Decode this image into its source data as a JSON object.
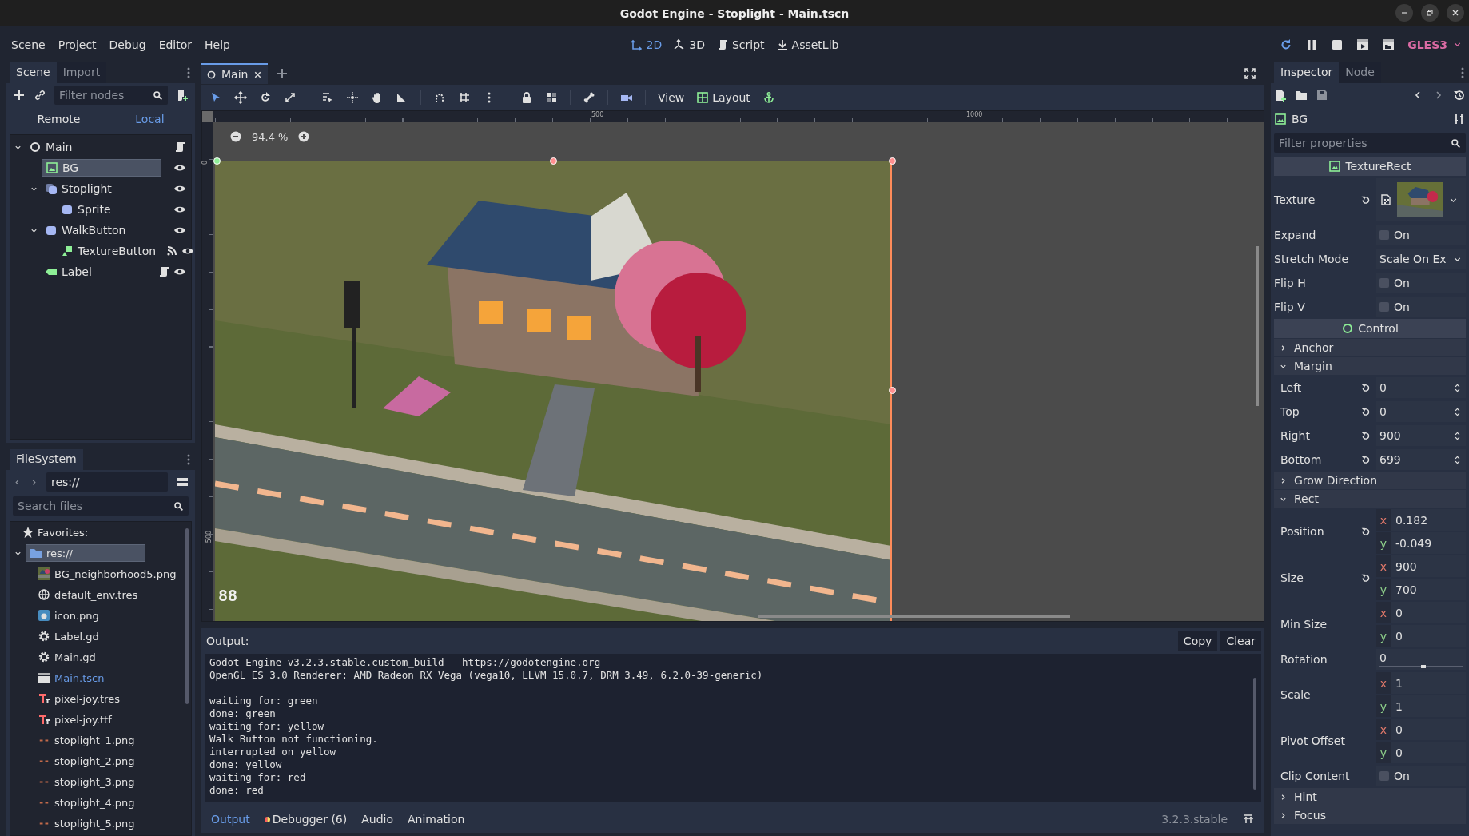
{
  "window": {
    "title": "Godot Engine - Stoplight - Main.tscn"
  },
  "menu": [
    "Scene",
    "Project",
    "Debug",
    "Editor",
    "Help"
  ],
  "workspaces": [
    {
      "label": "2D",
      "kind": "planar",
      "selected": true
    },
    {
      "label": "3D",
      "kind": "spatial",
      "selected": false
    },
    {
      "label": "Script",
      "kind": "script",
      "selected": false
    },
    {
      "label": "AssetLib",
      "kind": "assetlib",
      "selected": false
    }
  ],
  "renderer": "GLES3",
  "scene_dock": {
    "tabs": [
      {
        "label": "Scene",
        "selected": true
      },
      {
        "label": "Import",
        "selected": false
      }
    ],
    "filter": {
      "placeholder": "Filter nodes"
    },
    "modes": [
      {
        "label": "Remote",
        "selected": false
      },
      {
        "label": "Local",
        "selected": true
      }
    ],
    "tree": [
      {
        "name": "Main",
        "kind": "node",
        "script": true,
        "signals": false,
        "selected": false,
        "expanded": true,
        "children": [
          {
            "name": "BG",
            "kind": "texture_rect",
            "script": false,
            "signals": false,
            "selected": true
          },
          {
            "name": "Stoplight",
            "kind": "animated_sprite",
            "script": false,
            "signals": false,
            "selected": false,
            "expanded": true,
            "children": [
              {
                "name": "Sprite",
                "kind": "sprite",
                "script": false,
                "signals": false,
                "selected": false
              }
            ]
          },
          {
            "name": "WalkButton",
            "kind": "sprite",
            "script": false,
            "signals": false,
            "selected": false,
            "expanded": true,
            "children": [
              {
                "name": "TextureButton",
                "kind": "texture_button",
                "script": false,
                "signals": true,
                "selected": false
              }
            ]
          },
          {
            "name": "Label",
            "kind": "label",
            "script": true,
            "signals": false,
            "selected": false
          }
        ]
      }
    ]
  },
  "filesystem": {
    "tabs": [
      {
        "label": "FileSystem",
        "selected": true
      }
    ],
    "path": "res://",
    "search": {
      "placeholder": "Search files"
    },
    "favorites": "Favorites:",
    "tree": [
      {
        "name": "res://",
        "kind": "folder",
        "selected": true,
        "open": false,
        "expanded": true,
        "children": [
          {
            "name": "BG_neighborhood5.png",
            "kind": "thumbnail",
            "selected": false,
            "open": false
          },
          {
            "name": "default_env.tres",
            "kind": "environment",
            "selected": false,
            "open": false
          },
          {
            "name": "icon.png",
            "kind": "app_image",
            "selected": false,
            "open": false
          },
          {
            "name": "Label.gd",
            "kind": "script",
            "selected": false,
            "open": false
          },
          {
            "name": "Main.gd",
            "kind": "script",
            "selected": false,
            "open": false
          },
          {
            "name": "Main.tscn",
            "kind": "scene",
            "selected": false,
            "open": true
          },
          {
            "name": "pixel-joy.tres",
            "kind": "font",
            "selected": false,
            "open": false
          },
          {
            "name": "pixel-joy.ttf",
            "kind": "font",
            "selected": false,
            "open": false
          },
          {
            "name": "stoplight_1.png",
            "kind": "frame",
            "selected": false,
            "open": false
          },
          {
            "name": "stoplight_2.png",
            "kind": "frame",
            "selected": false,
            "open": false
          },
          {
            "name": "stoplight_3.png",
            "kind": "frame",
            "selected": false,
            "open": false
          },
          {
            "name": "stoplight_4.png",
            "kind": "frame",
            "selected": false,
            "open": false
          },
          {
            "name": "stoplight_5.png",
            "kind": "frame",
            "selected": false,
            "open": false
          }
        ]
      }
    ]
  },
  "editor": {
    "tabs": [
      {
        "label": "Main",
        "selected": true
      }
    ],
    "view_menu": "View",
    "layout_menu": "Layout",
    "zoom": "94.4 %",
    "ruler": {
      "x_labels": [
        "500",
        "1000"
      ],
      "y_labels": [
        "0",
        "500"
      ]
    },
    "canvas_label": "88"
  },
  "output": {
    "title": "Output:",
    "buttons": [
      "Copy",
      "Clear"
    ],
    "blocks": [
      [
        "Godot Engine v3.2.3.stable.custom_build - https://godotengine.org",
        "OpenGL ES 3.0 Renderer: AMD Radeon RX Vega (vega10, LLVM 15.0.7, DRM 3.49, 6.2.0-39-generic)"
      ],
      [
        "waiting for: green",
        "done: green",
        "waiting for: yellow",
        "Walk Button not functioning.",
        "interrupted on yellow",
        "done: yellow",
        "waiting for: red",
        "done: red"
      ]
    ]
  },
  "bottom_tabs": [
    {
      "label": "Output",
      "selected": true
    },
    {
      "label": "Debugger (6)",
      "selected": false
    },
    {
      "label": "Audio",
      "selected": false
    },
    {
      "label": "Animation",
      "selected": false
    }
  ],
  "version": "3.2.3.stable",
  "inspector": {
    "tabs": [
      {
        "label": "Inspector",
        "selected": true
      },
      {
        "label": "Node",
        "selected": false
      }
    ],
    "object": "BG",
    "filter": {
      "placeholder": "Filter properties"
    },
    "properties": [
      {
        "kind": "header",
        "label": "TextureRect"
      },
      {
        "kind": "texture",
        "label": "Texture",
        "revert": true
      },
      {
        "kind": "check",
        "label": "Expand",
        "checked": false,
        "text": "On"
      },
      {
        "kind": "enum",
        "label": "Stretch Mode",
        "value": "Scale On Ex"
      },
      {
        "kind": "check",
        "label": "Flip H",
        "checked": false,
        "text": "On"
      },
      {
        "kind": "check",
        "label": "Flip V",
        "checked": false,
        "text": "On"
      },
      {
        "kind": "header",
        "label": "Control"
      },
      {
        "kind": "group",
        "label": "Anchor",
        "expanded": false
      },
      {
        "kind": "group",
        "label": "Margin",
        "expanded": true,
        "children": [
          {
            "kind": "spin",
            "label": "Left",
            "value": "0",
            "revert": true
          },
          {
            "kind": "spin",
            "label": "Top",
            "value": "0",
            "revert": true
          },
          {
            "kind": "spin",
            "label": "Right",
            "value": "900",
            "revert": true
          },
          {
            "kind": "spin",
            "label": "Bottom",
            "value": "699",
            "revert": true
          }
        ]
      },
      {
        "kind": "group",
        "label": "Grow Direction",
        "expanded": false
      },
      {
        "kind": "group",
        "label": "Rect",
        "expanded": true,
        "children": [
          {
            "kind": "vector",
            "label": "Position",
            "revert": true,
            "components": [
              {
                "axis": "x",
                "value": "0.182"
              },
              {
                "axis": "y",
                "value": "-0.049"
              }
            ]
          },
          {
            "kind": "vector",
            "label": "Size",
            "revert": true,
            "components": [
              {
                "axis": "x",
                "value": "900"
              },
              {
                "axis": "y",
                "value": "700"
              }
            ]
          },
          {
            "kind": "vector",
            "label": "Min Size",
            "revert": false,
            "components": [
              {
                "axis": "x",
                "value": "0"
              },
              {
                "axis": "y",
                "value": "0"
              }
            ]
          },
          {
            "kind": "slider",
            "label": "Rotation",
            "value": "0",
            "level": 0.5
          },
          {
            "kind": "vector",
            "label": "Scale",
            "revert": false,
            "components": [
              {
                "axis": "x",
                "value": "1"
              },
              {
                "axis": "y",
                "value": "1"
              }
            ]
          },
          {
            "kind": "vector",
            "label": "Pivot Offset",
            "revert": false,
            "components": [
              {
                "axis": "x",
                "value": "0"
              },
              {
                "axis": "y",
                "value": "0"
              }
            ]
          },
          {
            "kind": "check",
            "label": "Clip Content",
            "checked": false,
            "text": "On"
          }
        ]
      },
      {
        "kind": "group",
        "label": "Hint",
        "expanded": false
      },
      {
        "kind": "group",
        "label": "Focus",
        "expanded": false
      }
    ]
  }
}
